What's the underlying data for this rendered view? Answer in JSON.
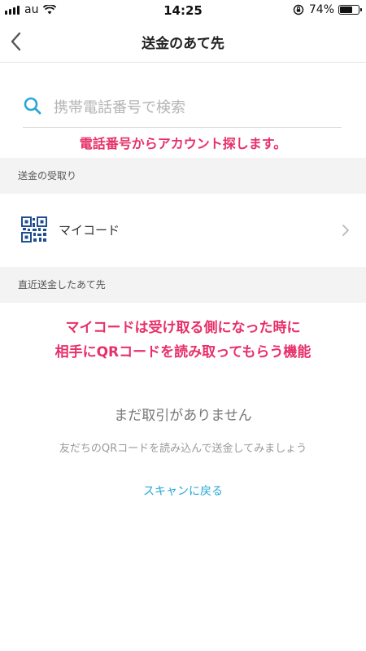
{
  "status_bar": {
    "carrier": "au",
    "time": "14:25",
    "battery_percent": "74%",
    "battery_level": 0.74
  },
  "nav": {
    "title": "送金のあて先"
  },
  "search": {
    "placeholder": "携帯電話番号で検索",
    "value": ""
  },
  "annotations": {
    "search_note": "電話番号からアカウント探します。",
    "mycode_note_line1": "マイコードは受け取る側になった時に",
    "mycode_note_line2": "相手にQRコードを読み取ってもらう機能"
  },
  "sections": {
    "receive_header": "送金の受取り",
    "my_code_label": "マイコード",
    "recent_header": "直近送金したあて先"
  },
  "empty_state": {
    "title": "まだ取引がありません",
    "description": "友だちのQRコードを読み込んで送金してみましょう",
    "scan_back_link": "スキャンに戻る"
  },
  "colors": {
    "accent": "#29a8d6",
    "annotation": "#e8306a",
    "qr_icon": "#1f4f8f"
  }
}
